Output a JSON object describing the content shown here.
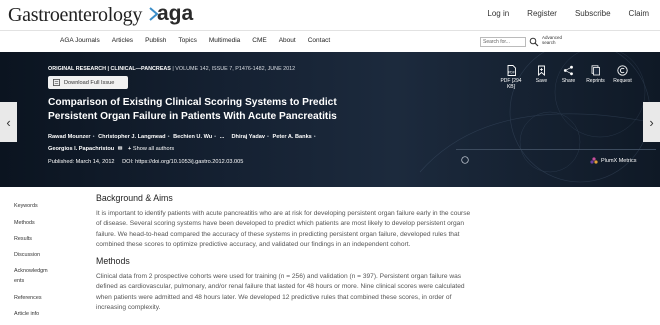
{
  "header": {
    "logo_text": "Gastroenterology",
    "aga_text": "aga",
    "links": [
      "Log in",
      "Register",
      "Subscribe",
      "Claim"
    ]
  },
  "nav": {
    "items": [
      "AGA Journals",
      "Articles",
      "Publish",
      "Topics",
      "Multimedia",
      "CME",
      "About",
      "Contact"
    ],
    "search_placeholder": "Search for...",
    "advanced_search": "Advanced search"
  },
  "article": {
    "type": "ORIGINAL RESEARCH | CLINICAL—PANCREAS",
    "volume": "| VOLUME 142, ISSUE 7, P1476-1482, JUNE 2012",
    "download_label": "Download Full Issue",
    "title": "Comparison of Existing Clinical Scoring Systems to Predict Persistent Organ Failure in Patients With Acute Pancreatitis",
    "authors": [
      "Rawad Mounzer",
      "Christopher J. Langmead",
      "Bechien U. Wu",
      "...",
      "Dhiraj Yadav",
      "Peter A. Banks",
      "Georgios I. Papachristou"
    ],
    "show_all": "Show all authors",
    "published_label": "Published: March 14, 2012",
    "doi_label": "DOI: https://doi.org/10.1053/j.gastro.2012.03.005",
    "plumx_label": "PlumX Metrics"
  },
  "tools": [
    {
      "label": "PDF [294 KB]",
      "icon": "pdf-icon"
    },
    {
      "label": "Save",
      "icon": "save-icon"
    },
    {
      "label": "Share",
      "icon": "share-icon"
    },
    {
      "label": "Reprints",
      "icon": "reprints-icon"
    },
    {
      "label": "Request",
      "icon": "copyright-icon"
    }
  ],
  "sidebar": {
    "items": [
      "Keywords",
      "Methods",
      "Results",
      "Discussion",
      "Acknowledgm",
      "ents",
      "References",
      "Article info"
    ]
  },
  "content": {
    "bg_heading": "Background & Aims",
    "bg_text": "It is important to identify patients with acute pancreatitis who are at risk for developing persistent organ failure early in the course of disease. Several scoring systems have been developed to predict which patients are most likely to develop persistent organ failure. We head-to-head compared the accuracy of these systems in predicting persistent organ failure, developed rules that combined these scores to optimize predictive accuracy, and validated our findings in an independent cohort.",
    "methods_heading": "Methods",
    "methods_text": "Clinical data from 2 prospective cohorts were used for training (n = 256) and validation (n = 397). Persistent organ failure was defined as cardiovascular, pulmonary, and/or renal failure that lasted for 48 hours or more. Nine clinical scores were calculated when patients were admitted and 48 hours later. We developed 12 predictive rules that combined these scores, in order of increasing complexity."
  },
  "colors": {
    "hero_bg": "#152132",
    "aga_accent": "#3a8dc8"
  }
}
